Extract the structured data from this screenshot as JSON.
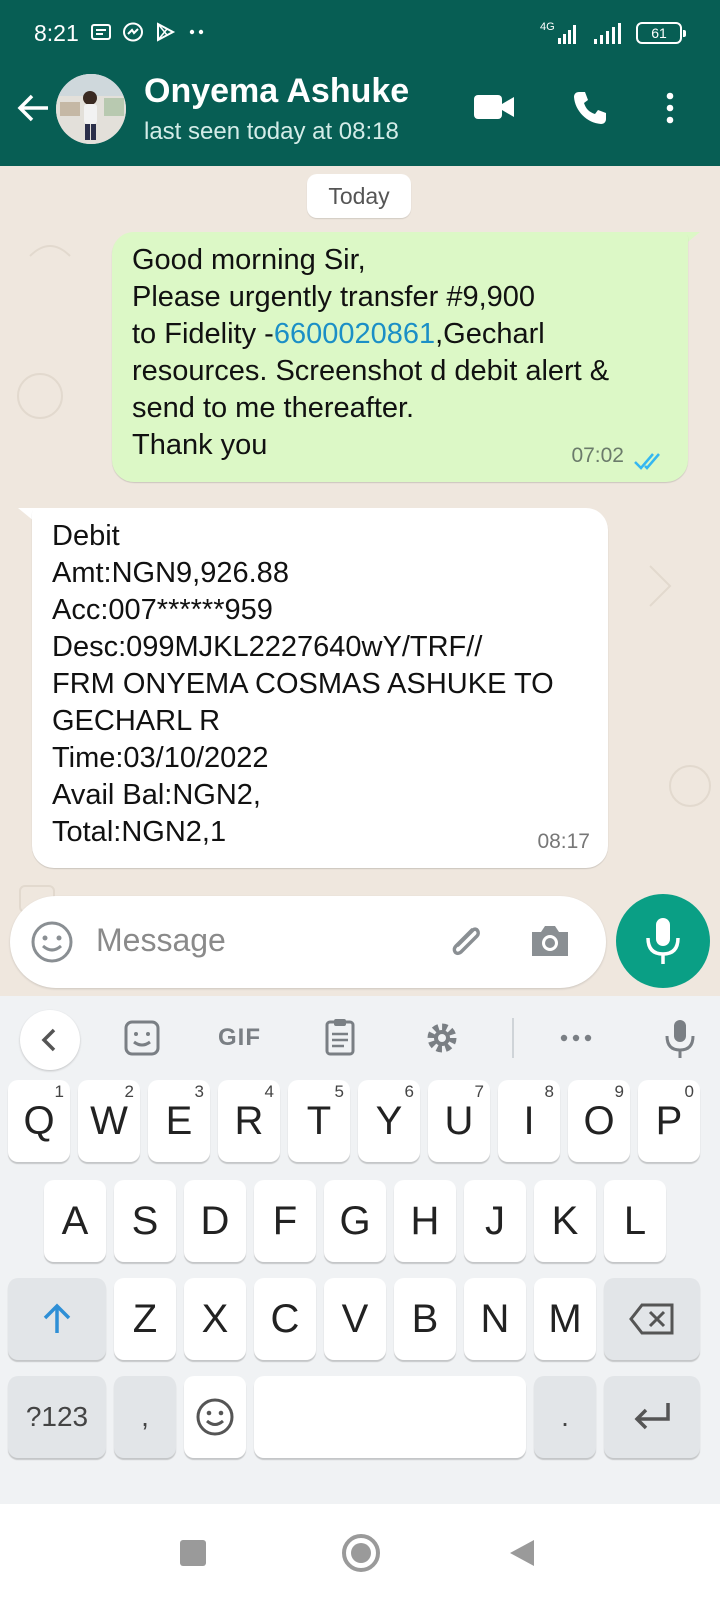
{
  "status_bar": {
    "time": "8:21",
    "network": "4G",
    "battery": "61"
  },
  "header": {
    "contact_name": "Onyema Ashuke",
    "last_seen": "last seen today at 08:18"
  },
  "chat": {
    "date_chip": "Today",
    "outgoing": {
      "lines": [
        "Good morning Sir,",
        "Please urgently transfer #9,900",
        "to Fidelity -",
        "6600020861",
        ",Gecharl",
        "resources. Screenshot d debit alert &",
        "send to me thereafter.",
        "Thank you"
      ],
      "time": "07:02",
      "status": "read-double-tick"
    },
    "incoming": {
      "lines": [
        "Debit",
        "Amt:NGN9,926.88",
        "Acc:007******959",
        "Desc:099MJKL2227640wY/TRF//",
        "FRM ONYEMA COSMAS ASHUKE TO",
        "GECHARL R",
        "Time:03/10/2022",
        "Avail Bal:NGN2,",
        "Total:NGN2,1"
      ],
      "time": "08:17"
    }
  },
  "input": {
    "placeholder": "Message"
  },
  "keyboard": {
    "gif_label": "GIF",
    "row1": [
      {
        "k": "Q",
        "h": "1"
      },
      {
        "k": "W",
        "h": "2"
      },
      {
        "k": "E",
        "h": "3"
      },
      {
        "k": "R",
        "h": "4"
      },
      {
        "k": "T",
        "h": "5"
      },
      {
        "k": "Y",
        "h": "6"
      },
      {
        "k": "U",
        "h": "7"
      },
      {
        "k": "I",
        "h": "8"
      },
      {
        "k": "O",
        "h": "9"
      },
      {
        "k": "P",
        "h": "0"
      }
    ],
    "row2": [
      "A",
      "S",
      "D",
      "F",
      "G",
      "H",
      "J",
      "K",
      "L"
    ],
    "row3": [
      "Z",
      "X",
      "C",
      "V",
      "B",
      "N",
      "M"
    ],
    "symbols_key": "?123",
    "comma_key": ",",
    "period_key": "."
  },
  "colors": {
    "header": "#075e54",
    "outgoing_bubble": "#dcf8c6",
    "mic_button": "#0a9f85",
    "link": "#1b8fc6",
    "read_ticks": "#34b7f1"
  }
}
